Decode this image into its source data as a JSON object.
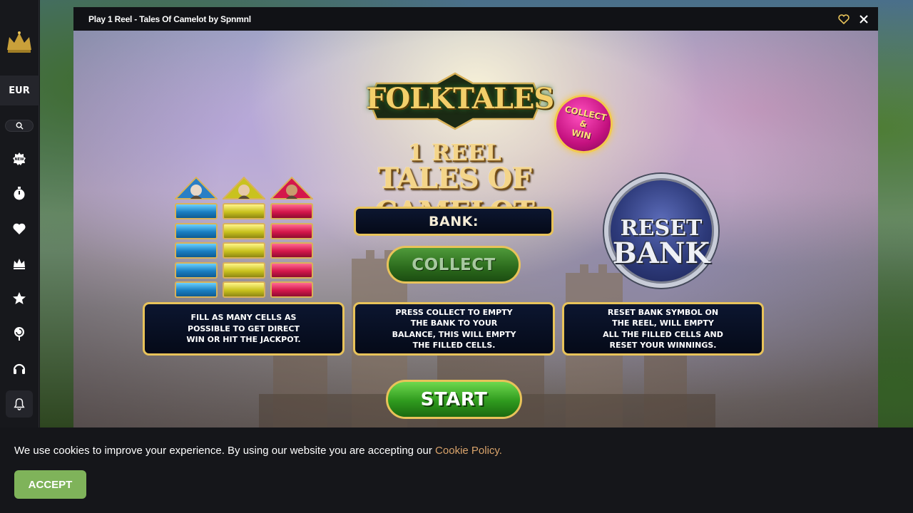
{
  "sidebar": {
    "currency": "EUR",
    "icons": [
      "crown-logo",
      "search-icon",
      "new-badge-icon",
      "stopwatch-icon",
      "heart-icon",
      "crown-icon",
      "star-icon",
      "lollipop-icon",
      "headset-icon",
      "bell-icon"
    ]
  },
  "modal": {
    "title": "Play 1 Reel - Tales Of Camelot by Spnmnl"
  },
  "game": {
    "logo": "FOLKTALES",
    "badge": "COLLECT\n&\nWIN",
    "title_line1": "1 REEL",
    "title_line2": "TALES OF CAMELOT",
    "bank_label": "BANK:",
    "collect_label": "COLLECT",
    "reset_line1": "RESET",
    "reset_line2": "BANK",
    "info": [
      "FILL AS MANY CELLS AS\nPOSSIBLE TO GET DIRECT\nWIN OR HIT THE JACKPOT.",
      "PRESS COLLECT TO EMPTY\nTHE BANK TO YOUR\nBALANCE, THIS WILL EMPTY\nTHE FILLED CELLS.",
      "RESET BANK SYMBOL ON\nTHE REEL, WILL EMPTY\nALL THE FILLED CELLS AND\nRESET YOUR WINNINGS."
    ],
    "start_label": "START",
    "cell_columns": [
      "blue",
      "yellow",
      "red"
    ]
  },
  "cookie": {
    "text": "We use cookies to improve your experience. By using our website you are accepting our ",
    "link": "Cookie Policy.",
    "accept": "ACCEPT"
  },
  "colors": {
    "accent_gold": "#e8c35a",
    "accept_green": "#7fb35a",
    "cookie_link": "#d9a36b"
  }
}
